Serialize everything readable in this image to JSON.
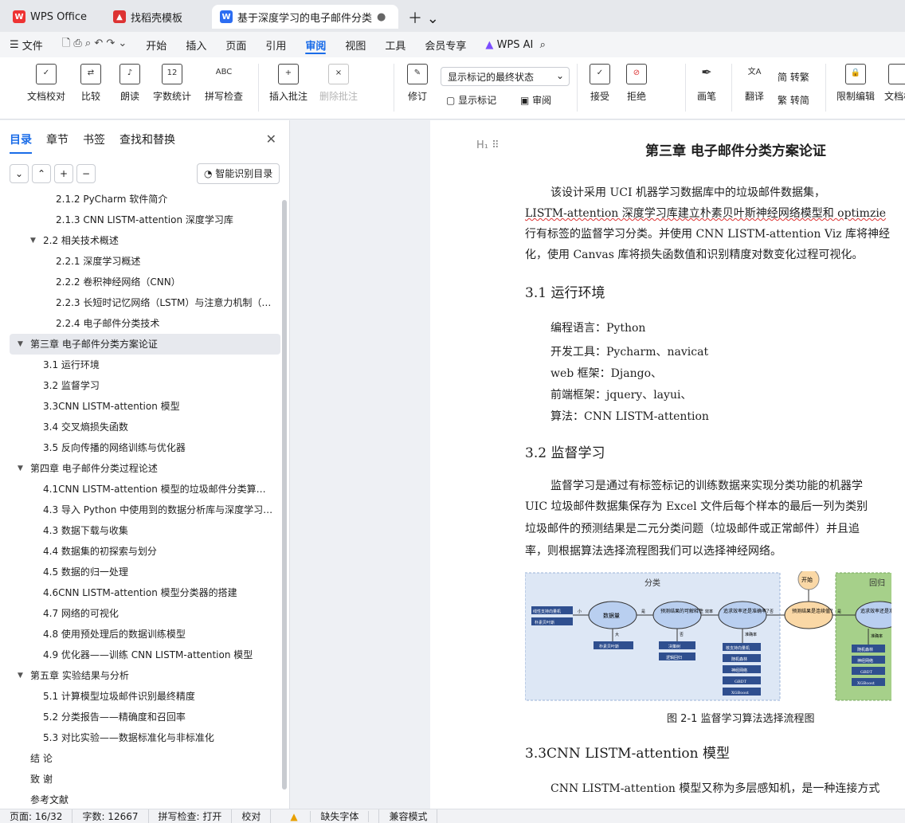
{
  "tabs": [
    {
      "label": "WPS Office",
      "color": "#e33"
    },
    {
      "label": "找稻壳模板",
      "color": "#d33"
    },
    {
      "label": "基于深度学习的电子邮件分类",
      "color": "#2c6df2"
    }
  ],
  "menu": [
    "文件",
    "开始",
    "插入",
    "页面",
    "引用",
    "审阅",
    "视图",
    "工具",
    "会员专享",
    "WPS AI"
  ],
  "ribbon": {
    "buttons": [
      "文档校对",
      "比较",
      "朗读",
      "字数统计",
      "拼写检查",
      "插入批注",
      "删除批注",
      "修订",
      "显示标记",
      "审阅",
      "接受",
      "拒绝",
      "画笔",
      "翻译",
      "转繁",
      "转简",
      "限制编辑",
      "文档权"
    ],
    "select": "显示标记的最终状态"
  },
  "sidebar": {
    "tabs": [
      "目录",
      "章节",
      "书签",
      "查找和替换"
    ],
    "smart_button": "智能识别目录",
    "toc": [
      {
        "t": "2.1.2 PyCharm 软件简介",
        "lv": 4
      },
      {
        "t": "2.1.3 CNN  LISTM-attention 深度学习库",
        "lv": 4
      },
      {
        "t": "2.2  相关技术概述",
        "lv": 3,
        "tg": true
      },
      {
        "t": "2.2.1  深度学习概述",
        "lv": 4
      },
      {
        "t": "2.2.2  卷积神经网络（CNN）",
        "lv": 4
      },
      {
        "t": "2.2.3  长短时记忆网络（LSTM）与注意力机制（…",
        "lv": 4
      },
      {
        "t": "2.2.4  电子邮件分类技术",
        "lv": 4
      },
      {
        "t": "第三章  电子邮件分类方案论证",
        "lv": 1,
        "tg": true,
        "sel": true
      },
      {
        "t": "3.1 运行环境",
        "lv": 2
      },
      {
        "t": "3.2 监督学习",
        "lv": 2
      },
      {
        "t": "3.3CNN   LISTM-attention 模型",
        "lv": 2
      },
      {
        "t": "3.4 交叉熵损失函数",
        "lv": 2
      },
      {
        "t": "3.5 反向传播的网络训练与优化器",
        "lv": 2
      },
      {
        "t": "第四章  电子邮件分类过程论述",
        "lv": 1,
        "tg": true
      },
      {
        "t": "4.1CNN   LISTM-attention 模型的垃圾邮件分类算…",
        "lv": 2
      },
      {
        "t": "4.3 导入 Python 中使用到的数据分析库与深度学习…",
        "lv": 2
      },
      {
        "t": "4.3 数据下载与收集",
        "lv": 2
      },
      {
        "t": "4.4 数据集的初探索与划分",
        "lv": 2
      },
      {
        "t": "4.5 数据的归一处理",
        "lv": 2
      },
      {
        "t": "4.6CNN   LISTM-attention 模型分类器的搭建",
        "lv": 2
      },
      {
        "t": "4.7 网络的可视化",
        "lv": 2
      },
      {
        "t": "4.8 使用预处理后的数据训练模型",
        "lv": 2
      },
      {
        "t": "4.9 优化器——训练 CNN   LISTM-attention 模型",
        "lv": 2
      },
      {
        "t": "第五章  实验结果与分析",
        "lv": 1,
        "tg": true
      },
      {
        "t": "5.1 计算模型垃圾邮件识别最终精度",
        "lv": 2
      },
      {
        "t": "5.2 分类报告——精确度和召回率",
        "lv": 2
      },
      {
        "t": "5.3 对比实验——数据标准化与非标准化",
        "lv": 2
      },
      {
        "t": "结    论",
        "lv": 1
      },
      {
        "t": "致    谢",
        "lv": 1
      },
      {
        "t": "参考文献",
        "lv": 1
      }
    ]
  },
  "doc": {
    "title": "第三章  电子邮件分类方案论证",
    "para1": [
      "该设计采用 UCI 机器学习数据库中的垃圾邮件数据集，",
      "LISTM-attention 深度学习库建立朴素贝叶斯神经网络模型和 optimzie",
      "行有标签的监督学习分类。并使用 CNN   LISTM-attention Viz 库将神经",
      "化，使用 Canvas 库将损失函数值和识别精度对数变化过程可视化。"
    ],
    "h31": "3.1 运行环境",
    "env": [
      "编程语言：Python",
      "开发工具：Pycharm、navicat",
      "web 框架：Django、",
      "前端框架：jquery、layui、",
      "算法：CNN    LISTM-attention"
    ],
    "h32": "3.2 监督学习",
    "para2": [
      "监督学习是通过有标签标记的训练数据来实现分类功能的机器学",
      "UIC 垃圾邮件数据集保存为 Excel 文件后每个样本的最后一列为类别",
      "垃圾邮件的预测结果是二元分类问题（垃圾邮件或正常邮件）并且追",
      "率，则根据算法选择流程图我们可以选择神经网络。"
    ],
    "caption": "图 2-1  监督学习算法选择流程图",
    "h33": "3.3CNN    LISTM-attention 模型",
    "para3": "CNN    LISTM-attention 模型又称为多层感知机，是一种连接方式",
    "flow": {
      "left_title": "分类",
      "right_title": "回归",
      "start": "开始",
      "nodes": [
        "数据量",
        "预测结果的可解释性",
        "追求效率还是准确率?",
        "预测结果是连续值?",
        "追求效率还是准确率?"
      ],
      "boxes_a": [
        "线性支持向量机",
        "朴素贝叶斯"
      ],
      "boxes_b": [
        "朴素贝叶斯"
      ],
      "boxes_c": [
        "决策树",
        "逻辑回归"
      ],
      "boxes_d": [
        "核支持向量机",
        "随机森林",
        "神经网络",
        "GBDT",
        "XGBoost"
      ],
      "boxes_e": [
        "随机森林",
        "神经网络",
        "GBDT",
        "XGBoost"
      ],
      "edge_labels": [
        "小",
        "大",
        "是",
        "否",
        "效率",
        "准确率",
        "是",
        "否",
        "准确率"
      ]
    }
  },
  "status": [
    "页面: 16/32",
    "字数: 12667",
    "拼写检查: 打开",
    "校对",
    "缺失字体",
    "兼容模式"
  ]
}
